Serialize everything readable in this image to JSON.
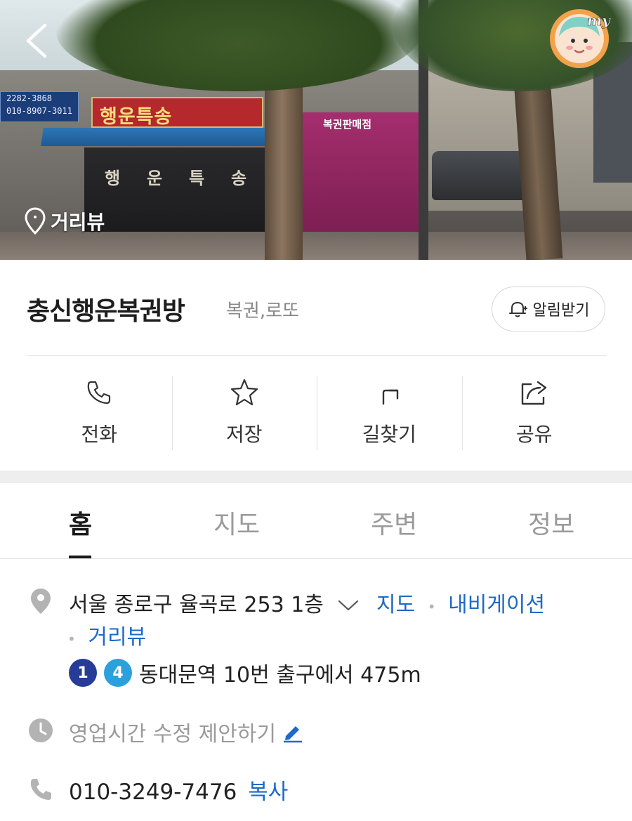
{
  "hero": {
    "street_view_label": "거리뷰",
    "signs": {
      "main_sign": "행운특송",
      "storefront_letters": [
        "행",
        "운",
        "특",
        "송"
      ],
      "phone_sign_line1": "2282-3868",
      "phone_sign_line2": "010-8907-3011",
      "lottery_shop_sign": "복권판매점"
    },
    "avatar_label": "my"
  },
  "place": {
    "name": "충신행운복권방",
    "category": "복권,로또",
    "notify_label": "알림받기"
  },
  "actions": [
    {
      "label": "전화",
      "icon": "phone-icon"
    },
    {
      "label": "저장",
      "icon": "star-icon"
    },
    {
      "label": "길찾기",
      "icon": "directions-icon"
    },
    {
      "label": "공유",
      "icon": "share-icon"
    }
  ],
  "tabs": [
    {
      "label": "홈",
      "active": true
    },
    {
      "label": "지도",
      "active": false
    },
    {
      "label": "주변",
      "active": false
    },
    {
      "label": "정보",
      "active": false
    }
  ],
  "info": {
    "address": "서울 종로구 율곡로 253 1층",
    "map_link": "지도",
    "navigation_link": "내비게이션",
    "streetview_link": "거리뷰",
    "subway_lines": [
      "1",
      "4"
    ],
    "subway_text": "동대문역 10번 출구에서 475m",
    "hours_text": "영업시간 수정 제안하기",
    "phone": "010-3249-7476",
    "copy_label": "복사"
  },
  "colors": {
    "link": "#1e69c9",
    "line1": "#263c96",
    "line4": "#2ca0dd",
    "text_main": "#222222",
    "text_muted": "#9a9a9a"
  }
}
